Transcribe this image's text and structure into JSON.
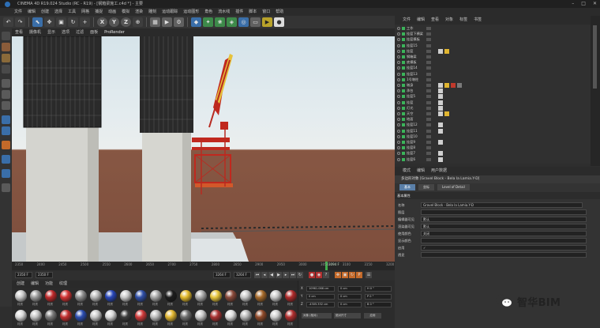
{
  "window": {
    "title": "CINEMA 4D R19.024 Studio (RC - R19) - [钢箱梁施工.c4d *] - 主要"
  },
  "menubar": [
    "文件",
    "编辑",
    "创建",
    "选择",
    "工具",
    "网格",
    "捕捉",
    "动画",
    "模拟",
    "渲染",
    "雕刻",
    "运动跟踪",
    "运动图形",
    "角色",
    "流水线",
    "插件",
    "脚本",
    "窗口",
    "帮助"
  ],
  "toolbar": {
    "undo_icon": "undo-icon",
    "axis_x": "X",
    "axis_y": "Y",
    "axis_z": "Z"
  },
  "viewport": {
    "menu": [
      "查看",
      "摄像机",
      "显示",
      "选项",
      "过滤",
      "面板",
      "ProRender"
    ],
    "camera_label": "Prorender"
  },
  "timeline": {
    "ticks": [
      "2350",
      "2400",
      "2450",
      "2500",
      "2550",
      "2600",
      "2650",
      "2700",
      "2750",
      "2800",
      "2850",
      "2900",
      "2950",
      "3000",
      "3050",
      "3100",
      "3150",
      "3200"
    ],
    "current_frame": "3094 F",
    "end_frame": "3264 F"
  },
  "playback": {
    "start_field": "2350 F",
    "min_field": "2350 F",
    "max_field": "3264 F",
    "end_field": "3264 F"
  },
  "materials": {
    "menu": [
      "创建",
      "编辑",
      "功能",
      "纹理"
    ],
    "balls": [
      {
        "color": "#c9c9c9",
        "label": "材质"
      },
      {
        "color": "#9a9a9a",
        "label": "材质"
      },
      {
        "color": "#c0292a",
        "label": "材质"
      },
      {
        "color": "#d23232",
        "label": "材质"
      },
      {
        "color": "#8e8e8e",
        "label": "材质"
      },
      {
        "color": "#b9b9b9",
        "label": "材质"
      },
      {
        "color": "#2746b8",
        "label": "材质"
      },
      {
        "color": "#c9c9c9",
        "label": "材质"
      },
      {
        "color": "#2f4fa8",
        "label": "材质"
      },
      {
        "color": "#a8a8a8",
        "label": "材质"
      },
      {
        "color": "#1d1d1d",
        "label": "材质"
      },
      {
        "color": "#e2b92a",
        "label": "材质"
      },
      {
        "color": "#a9a9a9",
        "label": "材质"
      },
      {
        "color": "#e5c43a",
        "label": "材质"
      },
      {
        "color": "#8a4a3a",
        "label": "材质"
      },
      {
        "color": "#c8c8c8",
        "label": "材质"
      },
      {
        "color": "#a66a2a",
        "label": "材质"
      },
      {
        "color": "#c9c9c9",
        "label": "材质"
      },
      {
        "color": "#b02a2a",
        "label": "材质"
      },
      {
        "color": "#d9d9d9",
        "label": "材质"
      },
      {
        "color": "#c4c4c4",
        "label": "材质"
      },
      {
        "color": "#7a7a7a",
        "label": "材质"
      },
      {
        "color": "#c22f2f",
        "label": "材质"
      },
      {
        "color": "#2b4db0",
        "label": "材质"
      },
      {
        "color": "#c9c9c9",
        "label": "材质"
      },
      {
        "color": "#d8d8d8",
        "label": "材质"
      },
      {
        "color": "#3c3c3c",
        "label": "材质"
      },
      {
        "color": "#d03a3a",
        "label": "材质"
      },
      {
        "color": "#bdbdbd",
        "label": "材质"
      },
      {
        "color": "#e0b530",
        "label": "材质"
      },
      {
        "color": "#6e6e6e",
        "label": "材质"
      },
      {
        "color": "#c9c9c9",
        "label": "材质"
      },
      {
        "color": "#a33",
        "label": "材质"
      },
      {
        "color": "#ddd",
        "label": "材质"
      },
      {
        "color": "#b8b8b8",
        "label": "材质"
      },
      {
        "color": "#904a2a",
        "label": "材质"
      },
      {
        "color": "#cfcfcf",
        "label": "材质"
      },
      {
        "color": "#b02f2f",
        "label": "材质"
      }
    ]
  },
  "coordinates": {
    "rows": [
      {
        "axis": "X",
        "pos": "10961.066 cm",
        "size": "0 cm",
        "rot": "H 0 °"
      },
      {
        "axis": "Y",
        "pos": "0 cm",
        "size": "0 cm",
        "rot": "P 0 °"
      },
      {
        "axis": "Z",
        "pos": "-4305.332 cm",
        "size": "0 cm",
        "rot": "B 0 °"
      }
    ],
    "mode": "对象 (相对)",
    "scale_mode": "绝对尺寸",
    "apply": "应用"
  },
  "object_manager": {
    "menu": [
      "文件",
      "编辑",
      "查看",
      "对象",
      "标签",
      "书签"
    ],
    "rows": [
      {
        "name": "工作",
        "tags": 0
      },
      {
        "name": "挂篮下横梁",
        "tags": 0
      },
      {
        "name": "挂篮模板",
        "tags": 0
      },
      {
        "name": "挂篮15",
        "tags": 0
      },
      {
        "name": "挂篮",
        "tags": 2
      },
      {
        "name": "钢箱梁",
        "tags": 0
      },
      {
        "name": "底模板",
        "tags": 0
      },
      {
        "name": "挂篮14",
        "tags": 0
      },
      {
        "name": "挂篮13",
        "tags": 0
      },
      {
        "name": "1号墩柱",
        "tags": 0
      },
      {
        "name": "墩身",
        "tags": 4
      },
      {
        "name": "承台",
        "tags": 1
      },
      {
        "name": "挂篮5",
        "tags": 1
      },
      {
        "name": "挂篮",
        "tags": 1
      },
      {
        "name": "灯光",
        "tags": 1
      },
      {
        "name": "天空",
        "tags": 2
      },
      {
        "name": "地面",
        "tags": 0
      },
      {
        "name": "挂篮12",
        "tags": 1
      },
      {
        "name": "挂篮11",
        "tags": 1
      },
      {
        "name": "挂篮10",
        "tags": 0
      },
      {
        "name": "挂篮9",
        "tags": 1
      },
      {
        "name": "挂篮8",
        "tags": 0
      },
      {
        "name": "挂篮7",
        "tags": 1
      },
      {
        "name": "挂篮6",
        "tags": 1
      }
    ]
  },
  "attributes": {
    "menu": [
      "模式",
      "编辑",
      "用户数据"
    ],
    "header": "多边形对象 [Gravel Block - Bela la Lamia.Y-D]",
    "tabs": [
      "基本",
      "坐标",
      "Level of Detail"
    ],
    "section": "基本属性",
    "props": [
      {
        "label": "名称",
        "value": "Gravel Block - Bela la Lamia.Y-D"
      },
      {
        "label": "图层",
        "value": ""
      },
      {
        "label": "编辑器可见",
        "value": "默认"
      },
      {
        "label": "渲染器可见",
        "value": "默认"
      },
      {
        "label": "使用颜色",
        "value": "关闭"
      },
      {
        "label": "显示颜色",
        "value": ""
      },
      {
        "label": "启用",
        "value": "✓"
      },
      {
        "label": "透显",
        "value": ""
      }
    ]
  },
  "watermark": {
    "text": "智华BIM"
  }
}
